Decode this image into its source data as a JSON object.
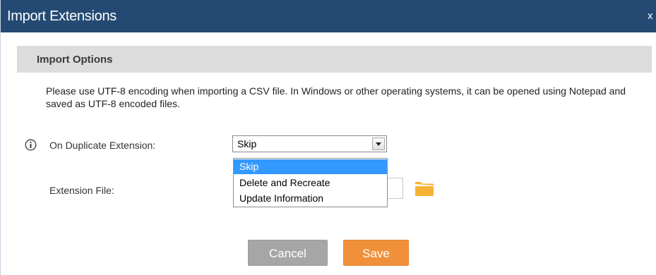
{
  "window": {
    "title": "Import Extensions",
    "close_label": "x"
  },
  "section": {
    "title": "Import Options"
  },
  "notice": {
    "text": "Please use UTF-8 encoding when importing a CSV file. In Windows or other operating systems, it can be opened using Notepad and saved as UTF-8 encoded files."
  },
  "fields": {
    "duplicate_label": "On Duplicate Extension:",
    "duplicate_value": "Skip",
    "file_label": "Extension File:"
  },
  "dropdown": {
    "options": [
      "Skip",
      "Delete and Recreate",
      "Update Information"
    ],
    "selected": "Skip"
  },
  "buttons": {
    "cancel": "Cancel",
    "save": "Save"
  },
  "colors": {
    "titlebar": "#244a73",
    "section_bg": "#dcdcdc",
    "highlight": "#3399ff",
    "cancel_bg": "#a6a6a6",
    "save_bg": "#f0903a",
    "folder": "#f5b335"
  },
  "icons": {
    "info": "info-circle-icon",
    "folder": "folder-icon",
    "dropdown_arrow": "chevron-down-icon"
  }
}
